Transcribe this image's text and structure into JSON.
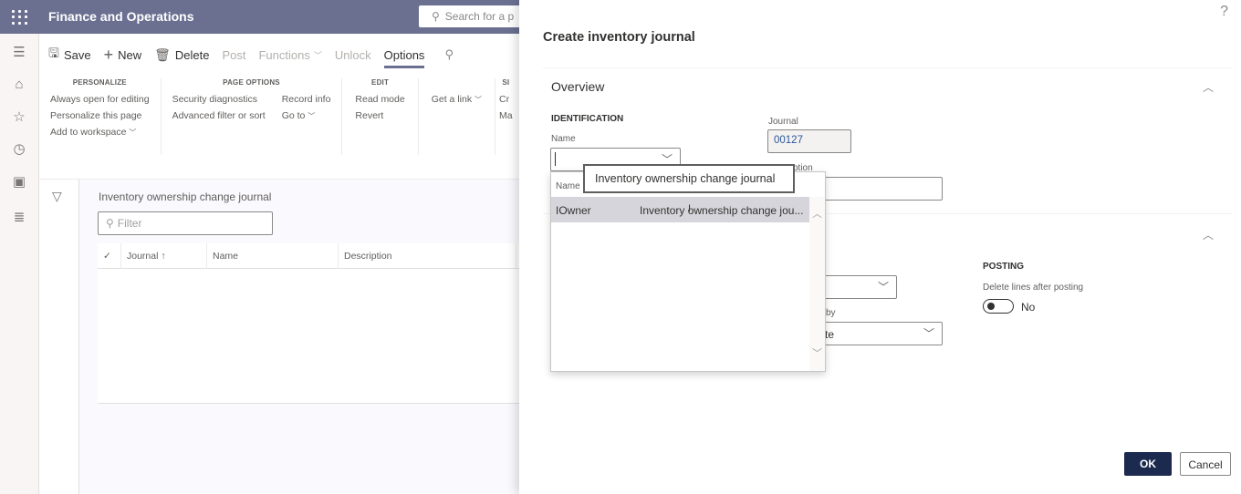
{
  "app": {
    "title": "Finance and Operations",
    "search_placeholder": "Search for a p"
  },
  "leftnav": {
    "items": [
      {
        "icon": "hamburger-icon",
        "glyph": "☰"
      },
      {
        "icon": "home-icon",
        "glyph": "⌂"
      },
      {
        "icon": "favorites-star-icon",
        "glyph": "☆"
      },
      {
        "icon": "recent-clock-icon",
        "glyph": "◷"
      },
      {
        "icon": "workspaces-icon",
        "glyph": "▣"
      },
      {
        "icon": "modules-list-icon",
        "glyph": "≣"
      }
    ]
  },
  "toolbar": {
    "save": "Save",
    "new": "New",
    "delete": "Delete",
    "post": "Post",
    "functions": "Functions",
    "unlock": "Unlock",
    "options": "Options"
  },
  "options_groups": {
    "personalize": {
      "title": "PERSONALIZE",
      "items": [
        "Always open for editing",
        "Personalize this page",
        "Add to workspace"
      ]
    },
    "page_options": {
      "title": "PAGE OPTIONS",
      "col1": [
        "Security diagnostics",
        "Advanced filter or sort"
      ],
      "col2": [
        "Record info",
        "Go to"
      ]
    },
    "edit": {
      "title": "EDIT",
      "items": [
        "Read mode",
        "Revert"
      ]
    },
    "share": {
      "items": [
        "Get a link"
      ]
    },
    "cut_group": {
      "title": "SI",
      "items": [
        "Cr",
        "Ma"
      ]
    }
  },
  "list": {
    "title": "Inventory ownership change journal",
    "filter_placeholder": "Filter",
    "columns": [
      "Journal",
      "Name",
      "Description"
    ]
  },
  "dialog": {
    "title": "Create inventory journal",
    "help": "?",
    "overview": {
      "title": "Overview",
      "identification_label": "IDENTIFICATION",
      "name_label": "Name",
      "name_value": "",
      "journal_label": "Journal",
      "journal_value": "00127",
      "description_label_partial": "ption"
    },
    "setup": {
      "selected_by_partial": "by",
      "selected_value_partial": "te",
      "posting_label": "POSTING",
      "delete_lines_label": "Delete lines after posting",
      "delete_lines_value": "No"
    },
    "ok": "OK",
    "cancel": "Cancel"
  },
  "lookup": {
    "header": "Name",
    "rows": [
      {
        "name": "IOwner",
        "description": "Inventory ownership change jou..."
      }
    ],
    "tooltip": "Inventory ownership change journal"
  }
}
